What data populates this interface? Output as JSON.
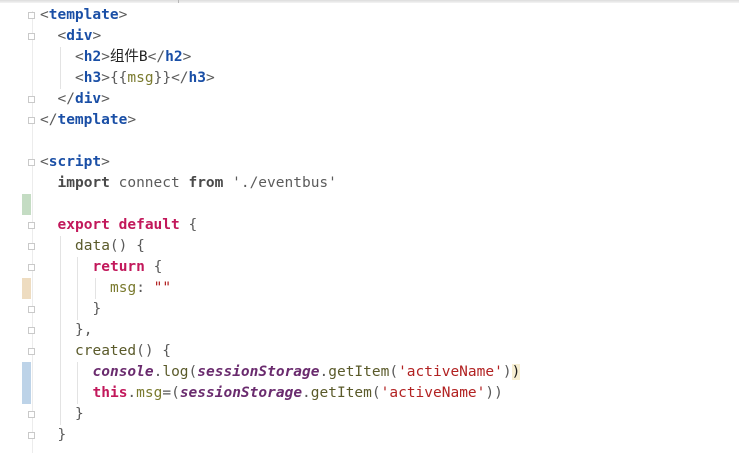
{
  "editor": {
    "lines": [
      {
        "indent": 0,
        "tokens": [
          {
            "t": "<",
            "c": "br"
          },
          {
            "t": "template",
            "c": "tag"
          },
          {
            "t": ">",
            "c": "br"
          }
        ]
      },
      {
        "indent": 1,
        "tokens": [
          {
            "t": "<",
            "c": "br"
          },
          {
            "t": "div",
            "c": "tag"
          },
          {
            "t": ">",
            "c": "br"
          }
        ]
      },
      {
        "indent": 2,
        "tokens": [
          {
            "t": "<",
            "c": "br"
          },
          {
            "t": "h2",
            "c": "tag"
          },
          {
            "t": ">",
            "c": "br"
          },
          {
            "t": "组件B",
            "c": "txt"
          },
          {
            "t": "</",
            "c": "br"
          },
          {
            "t": "h2",
            "c": "tag"
          },
          {
            "t": ">",
            "c": "br"
          }
        ]
      },
      {
        "indent": 2,
        "tokens": [
          {
            "t": "<",
            "c": "br"
          },
          {
            "t": "h3",
            "c": "tag"
          },
          {
            "t": ">",
            "c": "br"
          },
          {
            "t": "{{",
            "c": "br"
          },
          {
            "t": "msg",
            "c": "mus"
          },
          {
            "t": "}}",
            "c": "br"
          },
          {
            "t": "</",
            "c": "br"
          },
          {
            "t": "h3",
            "c": "tag"
          },
          {
            "t": ">",
            "c": "br"
          }
        ]
      },
      {
        "indent": 1,
        "tokens": [
          {
            "t": "</",
            "c": "br"
          },
          {
            "t": "div",
            "c": "tag"
          },
          {
            "t": ">",
            "c": "br"
          }
        ]
      },
      {
        "indent": 0,
        "tokens": [
          {
            "t": "</",
            "c": "br"
          },
          {
            "t": "template",
            "c": "tag"
          },
          {
            "t": ">",
            "c": "br"
          }
        ]
      },
      {
        "indent": 0,
        "tokens": []
      },
      {
        "indent": 0,
        "tokens": [
          {
            "t": "<",
            "c": "br"
          },
          {
            "t": "script",
            "c": "tag"
          },
          {
            "t": ">",
            "c": "br"
          }
        ]
      },
      {
        "indent": 1,
        "tokens": [
          {
            "t": "import",
            "c": "kwd"
          },
          {
            "t": " connect ",
            "c": "id"
          },
          {
            "t": "from",
            "c": "kwd"
          },
          {
            "t": " './eventbus'",
            "c": "id"
          }
        ]
      },
      {
        "indent": 0,
        "tokens": []
      },
      {
        "indent": 1,
        "tokens": [
          {
            "t": "export",
            "c": "kw"
          },
          {
            "t": " ",
            "c": "txt"
          },
          {
            "t": "default",
            "c": "kw"
          },
          {
            "t": " {",
            "c": "br"
          }
        ]
      },
      {
        "indent": 2,
        "tokens": [
          {
            "t": "data",
            "c": "fn"
          },
          {
            "t": "() {",
            "c": "br"
          }
        ]
      },
      {
        "indent": 3,
        "tokens": [
          {
            "t": "return",
            "c": "kw"
          },
          {
            "t": " {",
            "c": "br"
          }
        ]
      },
      {
        "indent": 4,
        "tokens": [
          {
            "t": "msg",
            "c": "prop"
          },
          {
            "t": ": ",
            "c": "br"
          },
          {
            "t": "\"\"",
            "c": "str"
          }
        ]
      },
      {
        "indent": 3,
        "tokens": [
          {
            "t": "}",
            "c": "br"
          }
        ]
      },
      {
        "indent": 2,
        "tokens": [
          {
            "t": "},",
            "c": "br"
          }
        ]
      },
      {
        "indent": 2,
        "tokens": [
          {
            "t": "created",
            "c": "fn"
          },
          {
            "t": "() {",
            "c": "br"
          }
        ]
      },
      {
        "indent": 3,
        "tokens": [
          {
            "t": "console",
            "c": "glob"
          },
          {
            "t": ".",
            "c": "br"
          },
          {
            "t": "log",
            "c": "fn"
          },
          {
            "t": "(",
            "c": "br"
          },
          {
            "t": "sessionStorage",
            "c": "glob"
          },
          {
            "t": ".",
            "c": "br"
          },
          {
            "t": "getItem",
            "c": "fn"
          },
          {
            "t": "(",
            "c": "br"
          },
          {
            "t": "'activeName'",
            "c": "str"
          },
          {
            "t": ")",
            "c": "br"
          },
          {
            "t": ")",
            "c": "caret-hl"
          }
        ]
      },
      {
        "indent": 3,
        "tokens": [
          {
            "t": "this",
            "c": "kw"
          },
          {
            "t": ".",
            "c": "br"
          },
          {
            "t": "msg",
            "c": "prop"
          },
          {
            "t": "=(",
            "c": "br"
          },
          {
            "t": "sessionStorage",
            "c": "glob"
          },
          {
            "t": ".",
            "c": "br"
          },
          {
            "t": "getItem",
            "c": "fn"
          },
          {
            "t": "(",
            "c": "br"
          },
          {
            "t": "'activeName'",
            "c": "str"
          },
          {
            "t": "))",
            "c": "br"
          }
        ]
      },
      {
        "indent": 2,
        "tokens": [
          {
            "t": "}",
            "c": "br"
          }
        ]
      },
      {
        "indent": 1,
        "tokens": [
          {
            "t": "}",
            "c": "br"
          }
        ]
      }
    ]
  },
  "gutter": {
    "fold_markers": [
      0,
      1,
      4,
      5,
      7,
      10,
      11,
      12,
      14,
      15,
      16,
      19,
      20
    ],
    "change_marks": [
      {
        "line": 9,
        "kind": "added"
      },
      {
        "line": 13,
        "kind": "modified"
      },
      {
        "line": 17,
        "kind": "edited",
        "span": 2
      }
    ]
  },
  "colors": {
    "tag": "#1a4fa6",
    "keyword": "#c2185b",
    "string": "#b22222",
    "global": "#6a2b6e",
    "function": "#5a5a2a"
  }
}
